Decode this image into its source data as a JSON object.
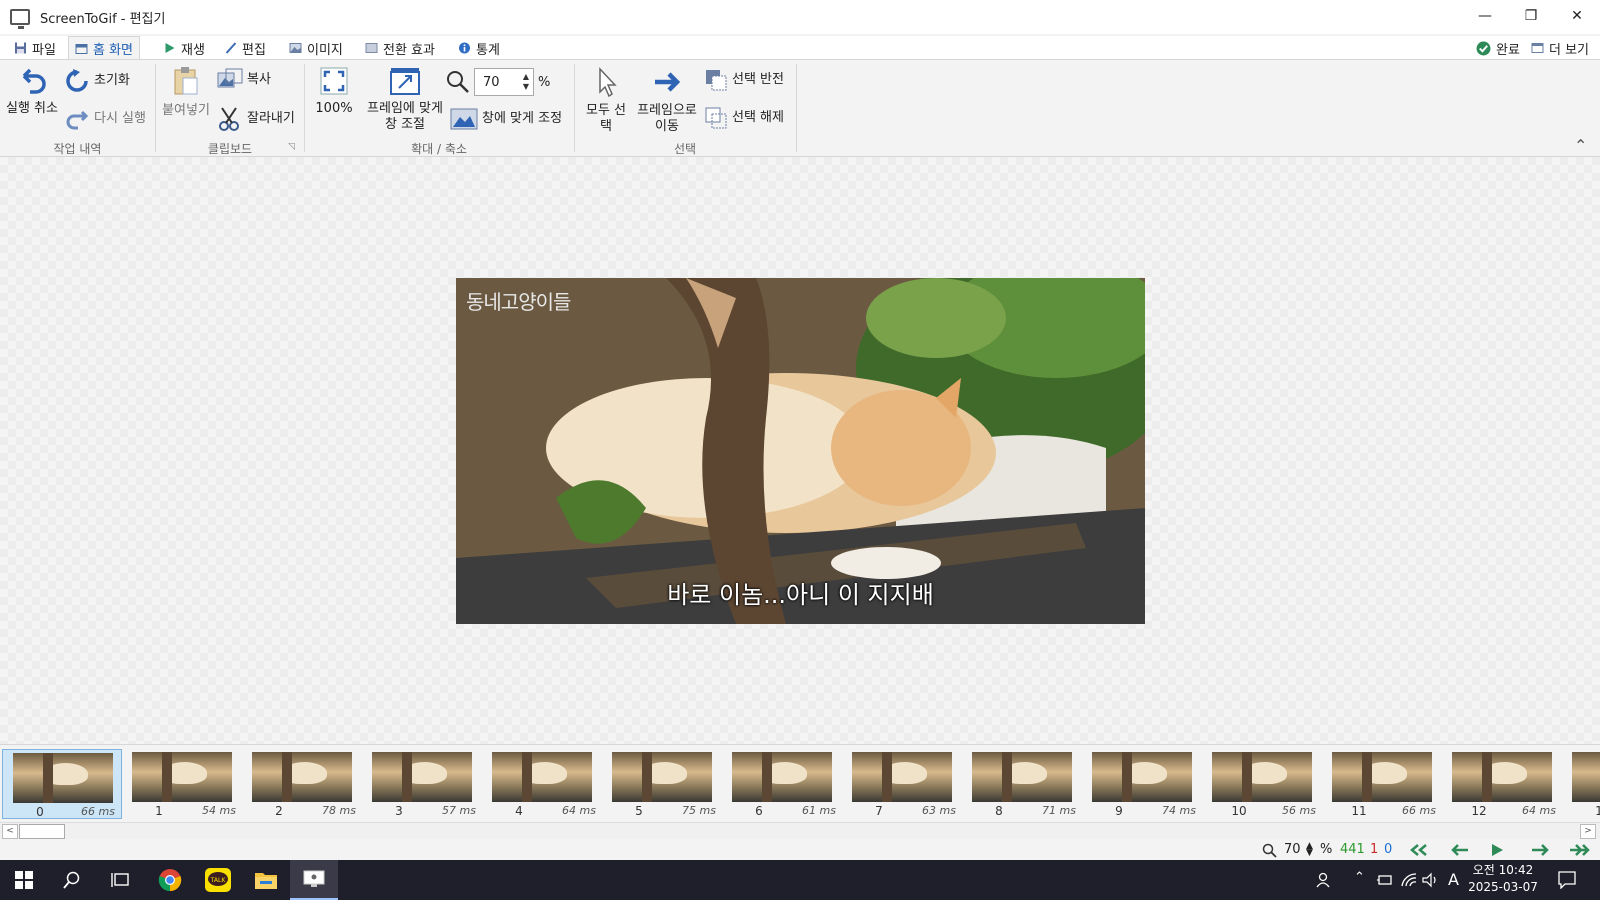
{
  "window": {
    "title": "ScreenToGif - 편집기",
    "minimize": "—",
    "restore": "❐",
    "close": "✕"
  },
  "menu": {
    "tabs": [
      {
        "label": "파일"
      },
      {
        "label": "홈 화면"
      },
      {
        "label": "재생"
      },
      {
        "label": "편집"
      },
      {
        "label": "이미지"
      },
      {
        "label": "전환 효과"
      },
      {
        "label": "통계"
      }
    ],
    "done": "완료",
    "more": "더 보기"
  },
  "ribbon": {
    "history": {
      "undo": "실행 취소",
      "reset": "초기화",
      "redo": "다시 실행",
      "label": "작업 내역"
    },
    "clipboard": {
      "paste": "붙여넣기",
      "copy": "복사",
      "cut": "잘라내기",
      "label": "클립보드"
    },
    "zoom": {
      "full": "100%",
      "fit_frame": "프레임에 맞게 창 조절",
      "value": "70",
      "unit": "%",
      "fit_window": "창에 맞게 조정",
      "label": "확대 / 축소"
    },
    "select": {
      "select_all": "모두 선택",
      "go_to": "프레임으로 이동",
      "invert": "선택 반전",
      "deselect": "선택 해제",
      "label": "선택"
    }
  },
  "preview": {
    "watermark": "동네고양이들",
    "subtitle": "바로 이놈...아니 이 지지배"
  },
  "frames": [
    {
      "num": "0",
      "dur": "66 ms"
    },
    {
      "num": "1",
      "dur": "54 ms"
    },
    {
      "num": "2",
      "dur": "78 ms"
    },
    {
      "num": "3",
      "dur": "57 ms"
    },
    {
      "num": "4",
      "dur": "64 ms"
    },
    {
      "num": "5",
      "dur": "75 ms"
    },
    {
      "num": "6",
      "dur": "61 ms"
    },
    {
      "num": "7",
      "dur": "63 ms"
    },
    {
      "num": "8",
      "dur": "71 ms"
    },
    {
      "num": "9",
      "dur": "74 ms"
    },
    {
      "num": "10",
      "dur": "56 ms"
    },
    {
      "num": "11",
      "dur": "66 ms"
    },
    {
      "num": "12",
      "dur": "64 ms"
    },
    {
      "num": "1",
      "dur": ""
    }
  ],
  "status": {
    "zoom": "70",
    "unit": "%",
    "total": "441",
    "selected": "1",
    "current": "0"
  },
  "taskbar": {
    "time": "오전 10:42",
    "date": "2025-03-07",
    "ime": "A"
  },
  "colors": {
    "accent": "#1e5fb4",
    "total": "#2e9a2e",
    "selected": "#cc2b2b",
    "current": "#1f6fd1"
  }
}
